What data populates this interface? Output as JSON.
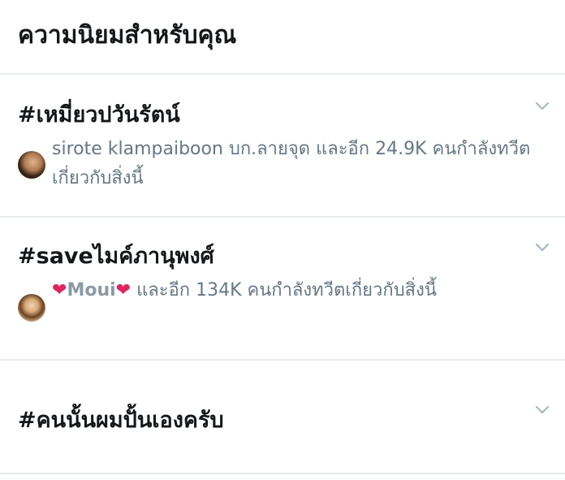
{
  "header": {
    "title": "ความนิยมสำหรับคุณ"
  },
  "trends": [
    {
      "hashtag": "#เหมี่ยวปวันรัตน์",
      "context_user": "sirote klampaiboon บก.ลายจุด",
      "context_text": " และอีก 24.9K คนกำลังทวีตเกี่ยวกับสิ่งนี้",
      "chevron_icon": "chevron-down-icon"
    },
    {
      "hashtag": "#saveไมค์ภานุพงศ์",
      "context_heart_left": "❤",
      "context_user": "Moui",
      "context_heart_right": "❤",
      "context_text": " และอีก 134K คนกำลังทวีตเกี่ยวกับสิ่งนี้",
      "chevron_icon": "chevron-down-icon"
    },
    {
      "hashtag": "#คนนั้นผมปั้นเองครับ",
      "chevron_icon": "chevron-down-icon"
    }
  ],
  "colors": {
    "text_primary": "#14171a",
    "text_secondary": "#657786",
    "divider": "#e6ecf0",
    "heart": "#e0245e",
    "chevron": "#aab8c2"
  }
}
